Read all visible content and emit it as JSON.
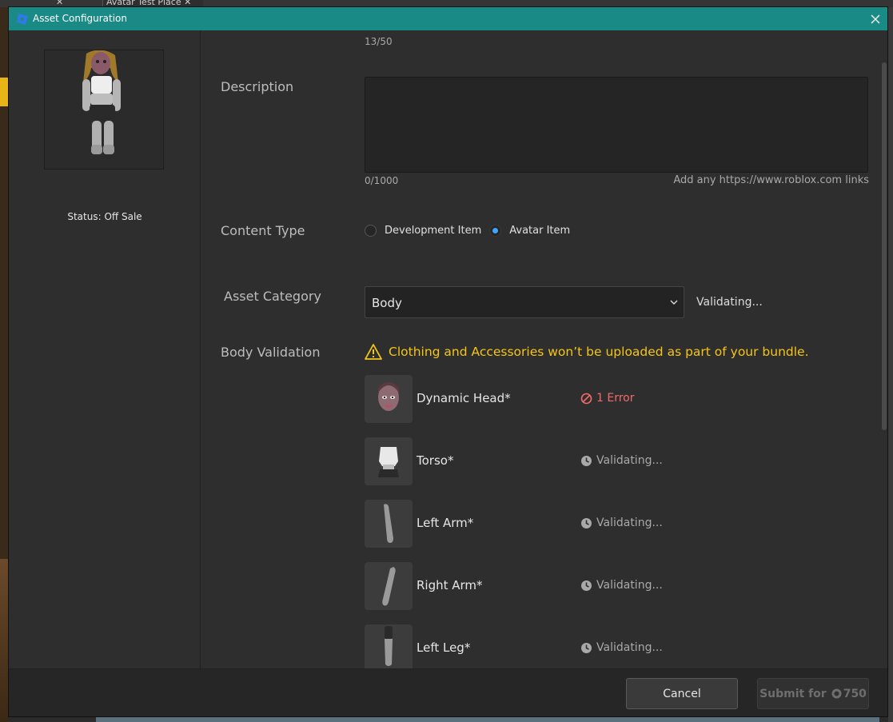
{
  "background": {
    "tab_1": "✕",
    "tab_2": "Avatar Test Place ✕"
  },
  "dialog": {
    "title": "Asset Configuration"
  },
  "left_panel": {
    "status": "Status: Off Sale"
  },
  "form": {
    "name_counter": "13/50",
    "description": {
      "label": "Description",
      "value": "",
      "counter": "0/1000",
      "hint": "Add any https://www.roblox.com links"
    },
    "content_type": {
      "label": "Content Type",
      "options": [
        {
          "label": "Development Item",
          "selected": false
        },
        {
          "label": "Avatar Item",
          "selected": true
        }
      ]
    },
    "asset_category": {
      "label": "Asset Category",
      "selected": "Body",
      "status": "Validating..."
    },
    "body_validation": {
      "label": "Body Validation",
      "warning": "Clothing and Accessories won’t be uploaded as part of your bundle.",
      "parts": [
        {
          "name": "Dynamic Head*",
          "status": "1 Error",
          "state": "error"
        },
        {
          "name": "Torso*",
          "status": "Validating...",
          "state": "pending"
        },
        {
          "name": "Left Arm*",
          "status": "Validating...",
          "state": "pending"
        },
        {
          "name": "Right Arm*",
          "status": "Validating...",
          "state": "pending"
        },
        {
          "name": "Left Leg*",
          "status": "Validating...",
          "state": "pending"
        }
      ]
    }
  },
  "footer": {
    "cancel_label": "Cancel",
    "submit_label": "Submit for",
    "submit_price": "750"
  },
  "colors": {
    "titlebar": "#1a8a87",
    "warning": "#f5c518",
    "error": "#f26a6a",
    "radio_selected": "#3ea6ff"
  },
  "icons": {
    "app": "studio-icon",
    "close": "close-icon",
    "warning": "warning-icon",
    "error": "no-entry-icon",
    "pending": "clock-icon",
    "dropdown": "chevron-down-icon",
    "currency": "robux-icon"
  }
}
